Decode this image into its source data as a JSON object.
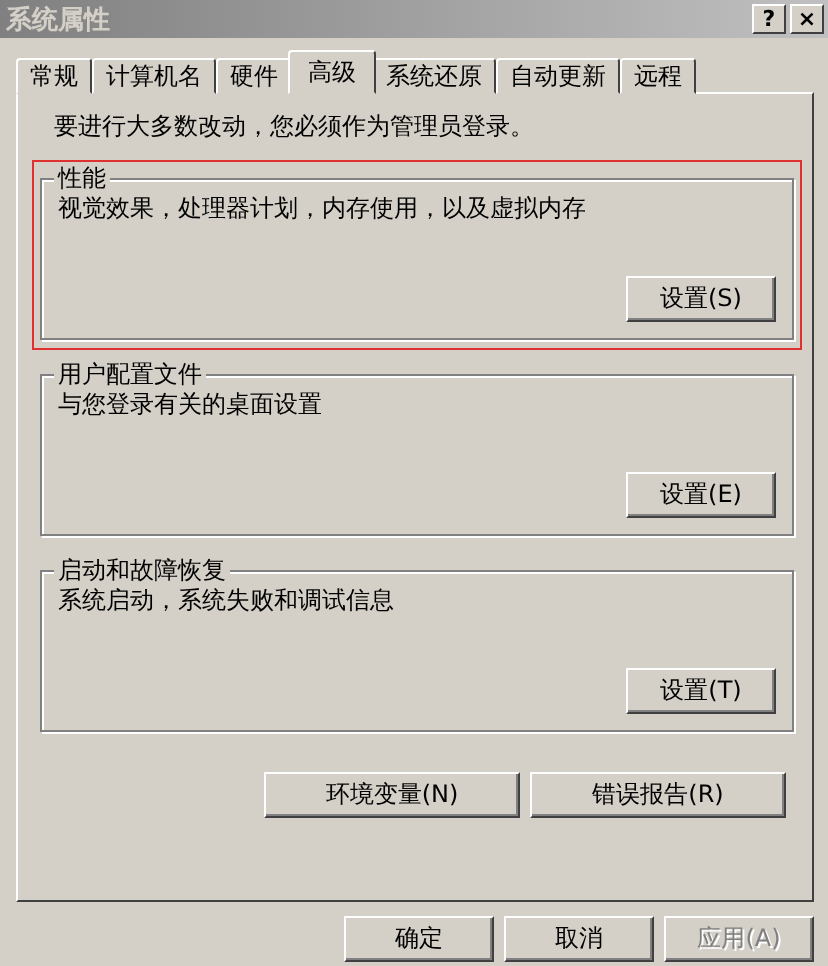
{
  "window": {
    "title": "系统属性",
    "title_buttons": [
      "?",
      "×"
    ]
  },
  "tabs": [
    {
      "label": "常规",
      "selected": false
    },
    {
      "label": "计算机名",
      "selected": false
    },
    {
      "label": "硬件",
      "selected": false
    },
    {
      "label": "高级",
      "selected": true
    },
    {
      "label": "系统还原",
      "selected": false
    },
    {
      "label": "自动更新",
      "selected": false
    },
    {
      "label": "远程",
      "selected": false
    }
  ],
  "notice": "要进行大多数改动，您必须作为管理员登录。",
  "groups": [
    {
      "title": "性能",
      "description": "视觉效果，处理器计划，内存使用，以及虚拟内存",
      "button": "设置(S)",
      "highlighted": true
    },
    {
      "title": "用户配置文件",
      "description": "与您登录有关的桌面设置",
      "button": "设置(E)",
      "highlighted": false
    },
    {
      "title": "启动和故障恢复",
      "description": "系统启动，系统失败和调试信息",
      "button": "设置(T)",
      "highlighted": false
    }
  ],
  "extra_buttons": [
    "环境变量(N)",
    "错误报告(R)"
  ],
  "footer_buttons": [
    {
      "label": "确定",
      "disabled": false
    },
    {
      "label": "取消",
      "disabled": false
    },
    {
      "label": "应用(A)",
      "disabled": true
    }
  ]
}
